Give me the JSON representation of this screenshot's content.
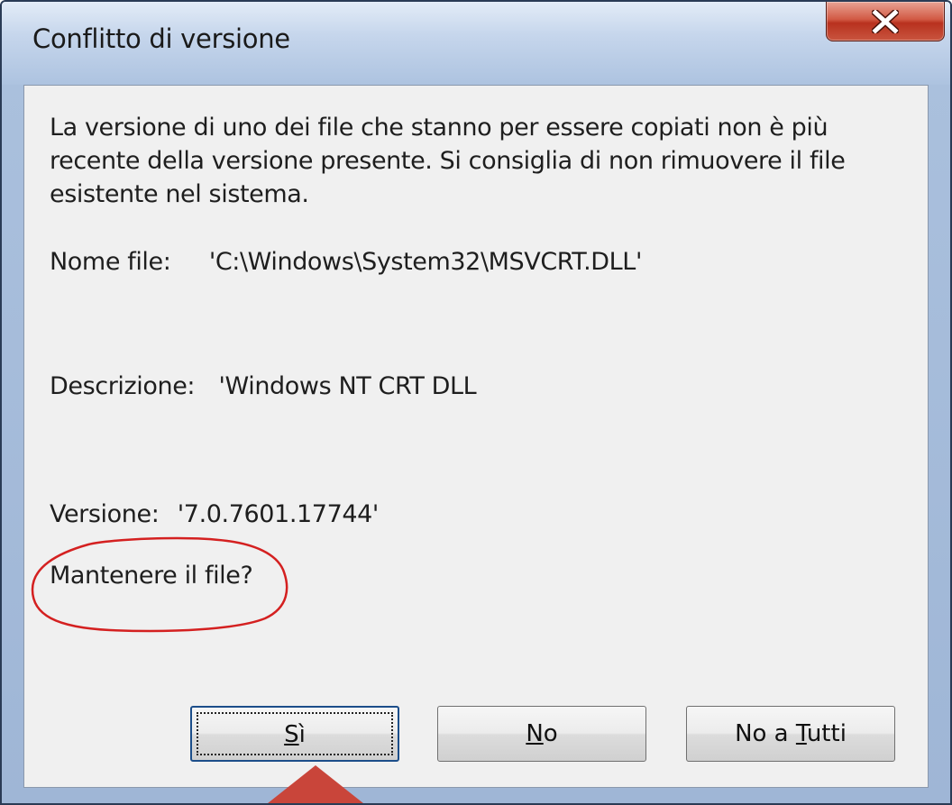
{
  "window": {
    "title": "Conflitto di versione",
    "close_icon": "close-icon"
  },
  "message": {
    "text": "La versione di uno dei file che stanno per essere copiati non è più recente della versione presente. Si consiglia di non rimuovere il file esistente nel sistema."
  },
  "details": {
    "filename_label": "Nome file:",
    "filename_value": "'C:\\Windows\\System32\\MSVCRT.DLL'",
    "description_label": "Descrizione:",
    "description_value": "'Windows NT CRT DLL",
    "version_label": "Versione:",
    "version_value": "'7.0.7601.17744'",
    "question": "Mantenere il file?"
  },
  "buttons": {
    "yes": {
      "pre": "",
      "accel": "S",
      "post": "ì"
    },
    "no": {
      "pre": "",
      "accel": "N",
      "post": "o"
    },
    "no_to_all": {
      "pre": "No a ",
      "accel": "T",
      "post": "utti"
    }
  },
  "colors": {
    "annotation": "#d42020",
    "arrow": "#c9453a",
    "close_button": "#c4412c"
  }
}
